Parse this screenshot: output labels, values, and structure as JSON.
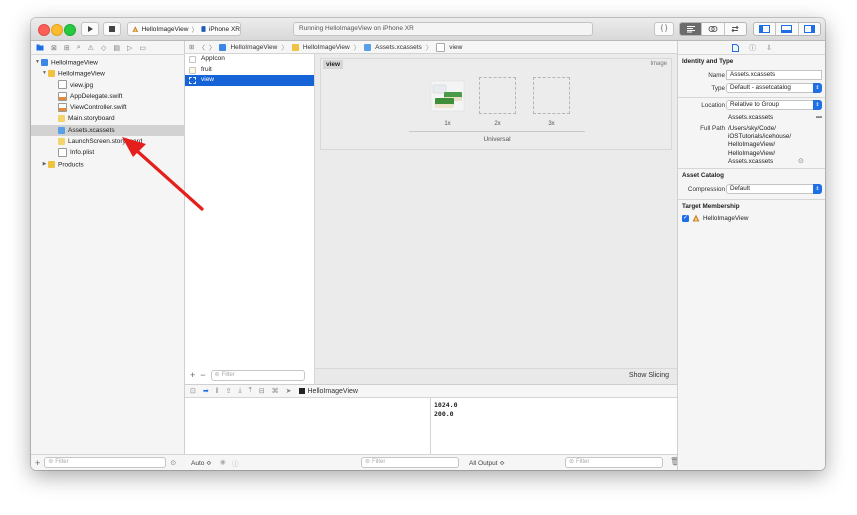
{
  "toolbar": {
    "scheme_name": "HelloImageView",
    "device_name": "iPhone XR",
    "activity_text": "Running HelloImageView on iPhone XR",
    "library_button": "{ }"
  },
  "navigator": {
    "items": [
      {
        "label": "HelloImageView",
        "icon": "project-icon",
        "level": 0,
        "disclosure": "open"
      },
      {
        "label": "HelloImageView",
        "icon": "folder-icon",
        "level": 1,
        "disclosure": "open"
      },
      {
        "label": "view.jpg",
        "icon": "image-file-icon",
        "level": 2
      },
      {
        "label": "AppDelegate.swift",
        "icon": "swift-file-icon",
        "level": 2
      },
      {
        "label": "ViewController.swift",
        "icon": "swift-file-icon",
        "level": 2
      },
      {
        "label": "Main.storyboard",
        "icon": "storyboard-icon",
        "level": 2
      },
      {
        "label": "Assets.xcassets",
        "icon": "asset-catalog-icon",
        "level": 2,
        "selected": true
      },
      {
        "label": "LaunchScreen.storyboard",
        "icon": "storyboard-icon",
        "level": 2
      },
      {
        "label": "Info.plist",
        "icon": "plist-icon",
        "level": 2
      },
      {
        "label": "Products",
        "icon": "folder-icon",
        "level": 1,
        "disclosure": "closed"
      }
    ],
    "filter_placeholder": "Filter"
  },
  "jumpbar": {
    "crumbs": [
      "HelloImageView",
      "HelloImageView",
      "Assets.xcassets",
      "view"
    ]
  },
  "asset_list": {
    "items": [
      {
        "label": "AppIcon",
        "selected": false
      },
      {
        "label": "fruit",
        "selected": false
      },
      {
        "label": "view",
        "selected": true
      }
    ],
    "filter_placeholder": "Filter"
  },
  "image_set": {
    "name": "view",
    "type_label": "Image",
    "slots": [
      "1x",
      "2x",
      "3x"
    ],
    "group_label": "Universal",
    "show_slicing": "Show Slicing"
  },
  "debug": {
    "process_name": "HelloImageView",
    "console_lines": [
      "1024.0",
      "200.0"
    ],
    "auto_label": "Auto ≎",
    "variables_filter": "Filter",
    "output_label": "All Output ≎",
    "console_filter": "Filter"
  },
  "inspector": {
    "identity_title": "Identity and Type",
    "name_label": "Name",
    "name_value": "Assets.xcassets",
    "type_label": "Type",
    "type_value": "Default - assetcatalog",
    "location_label": "Location",
    "location_value": "Relative to Group",
    "location_file": "Assets.xcassets",
    "fullpath_label": "Full Path",
    "fullpath_lines": [
      "/Users/sky/Code/",
      "iOSTutorials/icehouse/",
      "HelloImageView/",
      "HelloImageView/",
      "Assets.xcassets"
    ],
    "catalog_title": "Asset Catalog",
    "compression_label": "Compression",
    "compression_value": "Default",
    "membership_title": "Target Membership",
    "target_name": "HelloImageView"
  },
  "colors": {
    "accent": "#1663d8",
    "annotation_arrow": "#e5201c"
  }
}
